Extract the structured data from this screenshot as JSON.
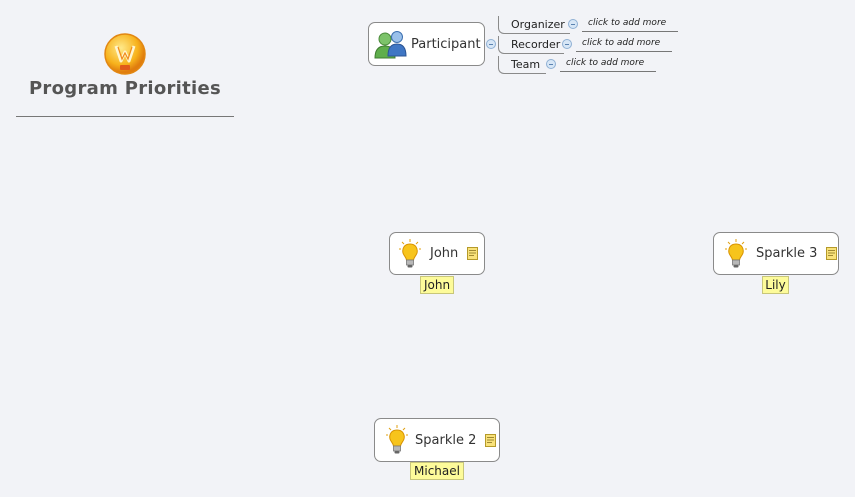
{
  "central": {
    "title": "Program Priorities",
    "icon": "lightbulb-logo-icon"
  },
  "participant": {
    "label": "Participant",
    "icon": "people-icon",
    "subtopics": [
      {
        "label": "Organizer",
        "add_more": "click to add more"
      },
      {
        "label": "Recorder",
        "add_more": "click to add more"
      },
      {
        "label": "Team",
        "add_more": "click to add more"
      }
    ]
  },
  "topics": [
    {
      "label": "John",
      "callout": "John"
    },
    {
      "label": "Sparkle 3",
      "callout": "Lily"
    },
    {
      "label": "Sparkle 2",
      "callout": "Michael"
    }
  ],
  "colors": {
    "background": "#f2f3f7",
    "callout": "#fdfb9a",
    "bulb": "#f6c21b"
  }
}
